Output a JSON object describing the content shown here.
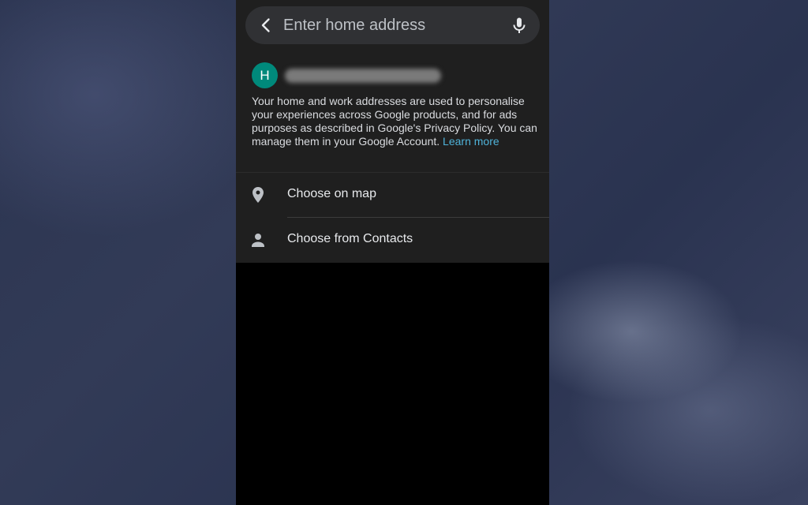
{
  "search": {
    "placeholder": "Enter home address",
    "back_icon": "arrow-back-icon",
    "mic_icon": "microphone-icon"
  },
  "account": {
    "avatar_initial": "H",
    "avatar_color": "#00897b",
    "email": ""
  },
  "privacy": {
    "text": "Your home and work addresses are used to personalise your experiences across Google products, and for ads purposes as described in Google's Privacy Policy. You can manage them in your Google Account.",
    "link_label": "Learn more",
    "link_color": "#4fb3d9"
  },
  "options": [
    {
      "label": "Choose on map",
      "icon": "map-pin-icon"
    },
    {
      "label": "Choose from Contacts",
      "icon": "person-icon"
    }
  ]
}
